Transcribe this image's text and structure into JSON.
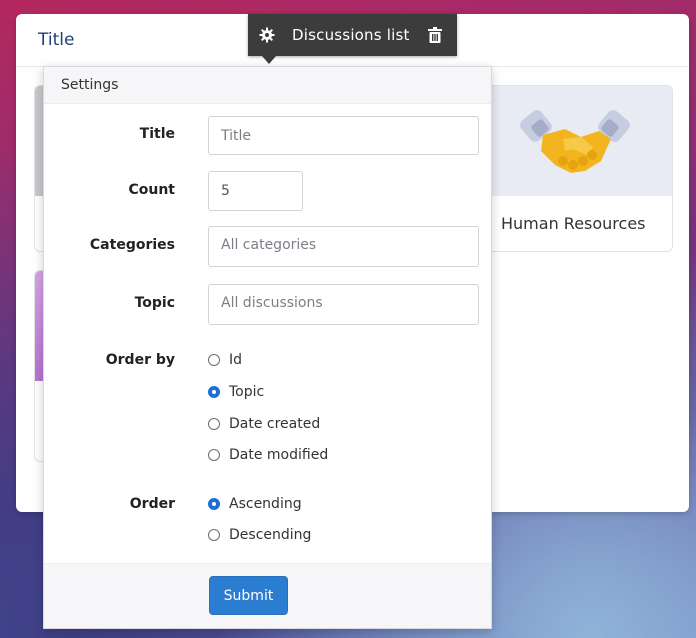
{
  "widget": {
    "title": "Title",
    "tiles": [
      {
        "label": "Human Resources",
        "icon": "handshake-icon"
      }
    ]
  },
  "toolbar": {
    "title": "Discussions list",
    "settings_icon": "gear-icon",
    "delete_icon": "trash-icon"
  },
  "settings": {
    "header": "Settings",
    "fields": {
      "title": {
        "label": "Title",
        "placeholder": "Title",
        "value": ""
      },
      "count": {
        "label": "Count",
        "value": "5"
      },
      "categories": {
        "label": "Categories",
        "value": "All categories"
      },
      "topic": {
        "label": "Topic",
        "value": "All discussions"
      }
    },
    "order_by": {
      "label": "Order by",
      "options": [
        "Id",
        "Topic",
        "Date created",
        "Date modified"
      ],
      "selected": "Topic"
    },
    "order": {
      "label": "Order",
      "options": [
        "Ascending",
        "Descending"
      ],
      "selected": "Ascending"
    },
    "submit_label": "Submit"
  },
  "colors": {
    "accent": "#2b7dd1",
    "toolbar_bg": "#3c3c3c",
    "title_color": "#1f3f77"
  }
}
